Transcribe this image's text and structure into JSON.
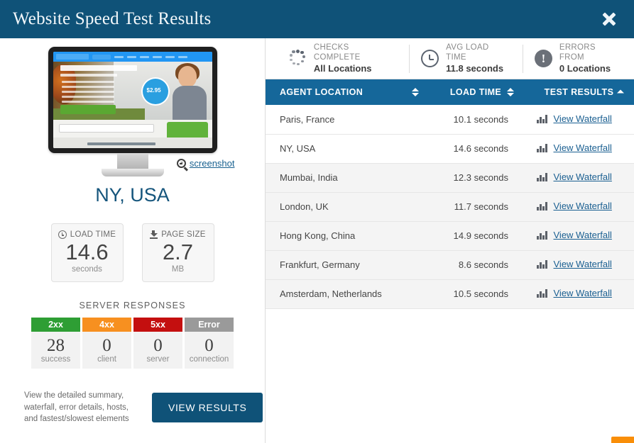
{
  "header": {
    "title": "Website Speed Test Results",
    "close_icon": "close-icon"
  },
  "stats": [
    {
      "icon": "spinner-icon",
      "label": "CHECKS COMPLETE",
      "value": "All Locations"
    },
    {
      "icon": "clock-icon",
      "label": "AVG LOAD TIME",
      "value": "11.8 seconds"
    },
    {
      "icon": "alert-circle-icon",
      "label": "ERRORS FROM",
      "value": "0 Locations"
    }
  ],
  "table": {
    "columns": [
      {
        "label": "AGENT LOCATION",
        "sort": "both"
      },
      {
        "label": "LOAD TIME",
        "sort": "both"
      },
      {
        "label": "TEST RESULTS",
        "sort": "asc"
      }
    ],
    "rows": [
      {
        "location": "Paris, France",
        "load_time": "10.1 seconds",
        "action": "View Waterfall"
      },
      {
        "location": "NY, USA",
        "load_time": "14.6 seconds",
        "action": "View Waterfall"
      },
      {
        "location": "Mumbai, India",
        "load_time": "12.3 seconds",
        "action": "View Waterfall"
      },
      {
        "location": "London, UK",
        "load_time": "11.7 seconds",
        "action": "View Waterfall"
      },
      {
        "location": "Hong Kong, China",
        "load_time": "14.9 seconds",
        "action": "View Waterfall"
      },
      {
        "location": "Frankfurt, Germany",
        "load_time": "8.6 seconds",
        "action": "View Waterfall"
      },
      {
        "location": "Amsterdam, Netherlands",
        "load_time": "10.5 seconds",
        "action": "View Waterfall"
      }
    ]
  },
  "left": {
    "screenshot_link": "screenshot",
    "screenshot_icon": "magnifier-zoom-icon",
    "location_title": "NY, USA",
    "preview": {
      "brand": "HostASP.NET",
      "headline": "Optimized Hosting for ASP.NET",
      "subhead": "100% Focused   The Best ASP.NET Hosting Solution",
      "cta": "Get Started Now",
      "price": "$2.95 /mo",
      "footer": "Get Started with HostASP.NET Hosting"
    },
    "metrics": [
      {
        "icon": "clock-icon",
        "label": "LOAD TIME",
        "value": "14.6",
        "unit": "seconds"
      },
      {
        "icon": "download-icon",
        "label": "PAGE SIZE",
        "value": "2.7",
        "unit": "MB"
      }
    ],
    "server_responses": {
      "title": "SERVER RESPONSES",
      "items": [
        {
          "code": "2xx",
          "count": "28",
          "label": "success",
          "color": "#2e9e34"
        },
        {
          "code": "4xx",
          "count": "0",
          "label": "client",
          "color": "#f79020"
        },
        {
          "code": "5xx",
          "count": "0",
          "label": "server",
          "color": "#c40f0f"
        },
        {
          "code": "Error",
          "count": "0",
          "label": "connection",
          "color": "#9a9a9a"
        }
      ]
    },
    "footer_text": "View the detailed summary, waterfall, error details, hosts, and fastest/slowest elements",
    "view_results_label": "VIEW RESULTS"
  },
  "colors": {
    "titlebar": "#0f5278",
    "table_header": "#15679a",
    "link": "#1a5f91",
    "accent_orange": "#f98e08"
  }
}
